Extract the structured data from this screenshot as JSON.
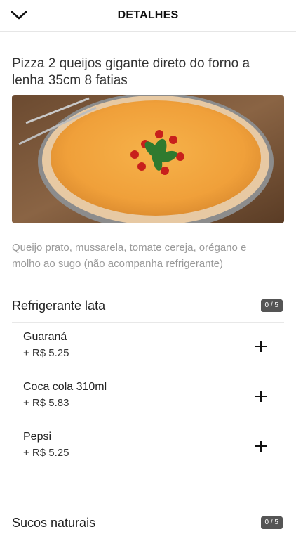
{
  "header": {
    "title": "DETALHES",
    "back_icon": "chevron-down-icon"
  },
  "product": {
    "title": "Pizza 2 queijos gigante direto do forno a lenha 35cm 8 fatias",
    "description": "Queijo prato, mussarela, tomate cereja, orégano e molho ao sugo (não acompanha refrigerante)"
  },
  "sections": [
    {
      "title": "Refrigerante lata",
      "counter": "0 / 5",
      "options": [
        {
          "name": "Guaraná",
          "price": "+ R$ 5.25"
        },
        {
          "name": "Coca cola 310ml",
          "price": "+ R$ 5.83"
        },
        {
          "name": "Pepsi",
          "price": "+ R$ 5.25"
        }
      ]
    },
    {
      "title": "Sucos naturais",
      "counter": "0 / 5"
    }
  ]
}
